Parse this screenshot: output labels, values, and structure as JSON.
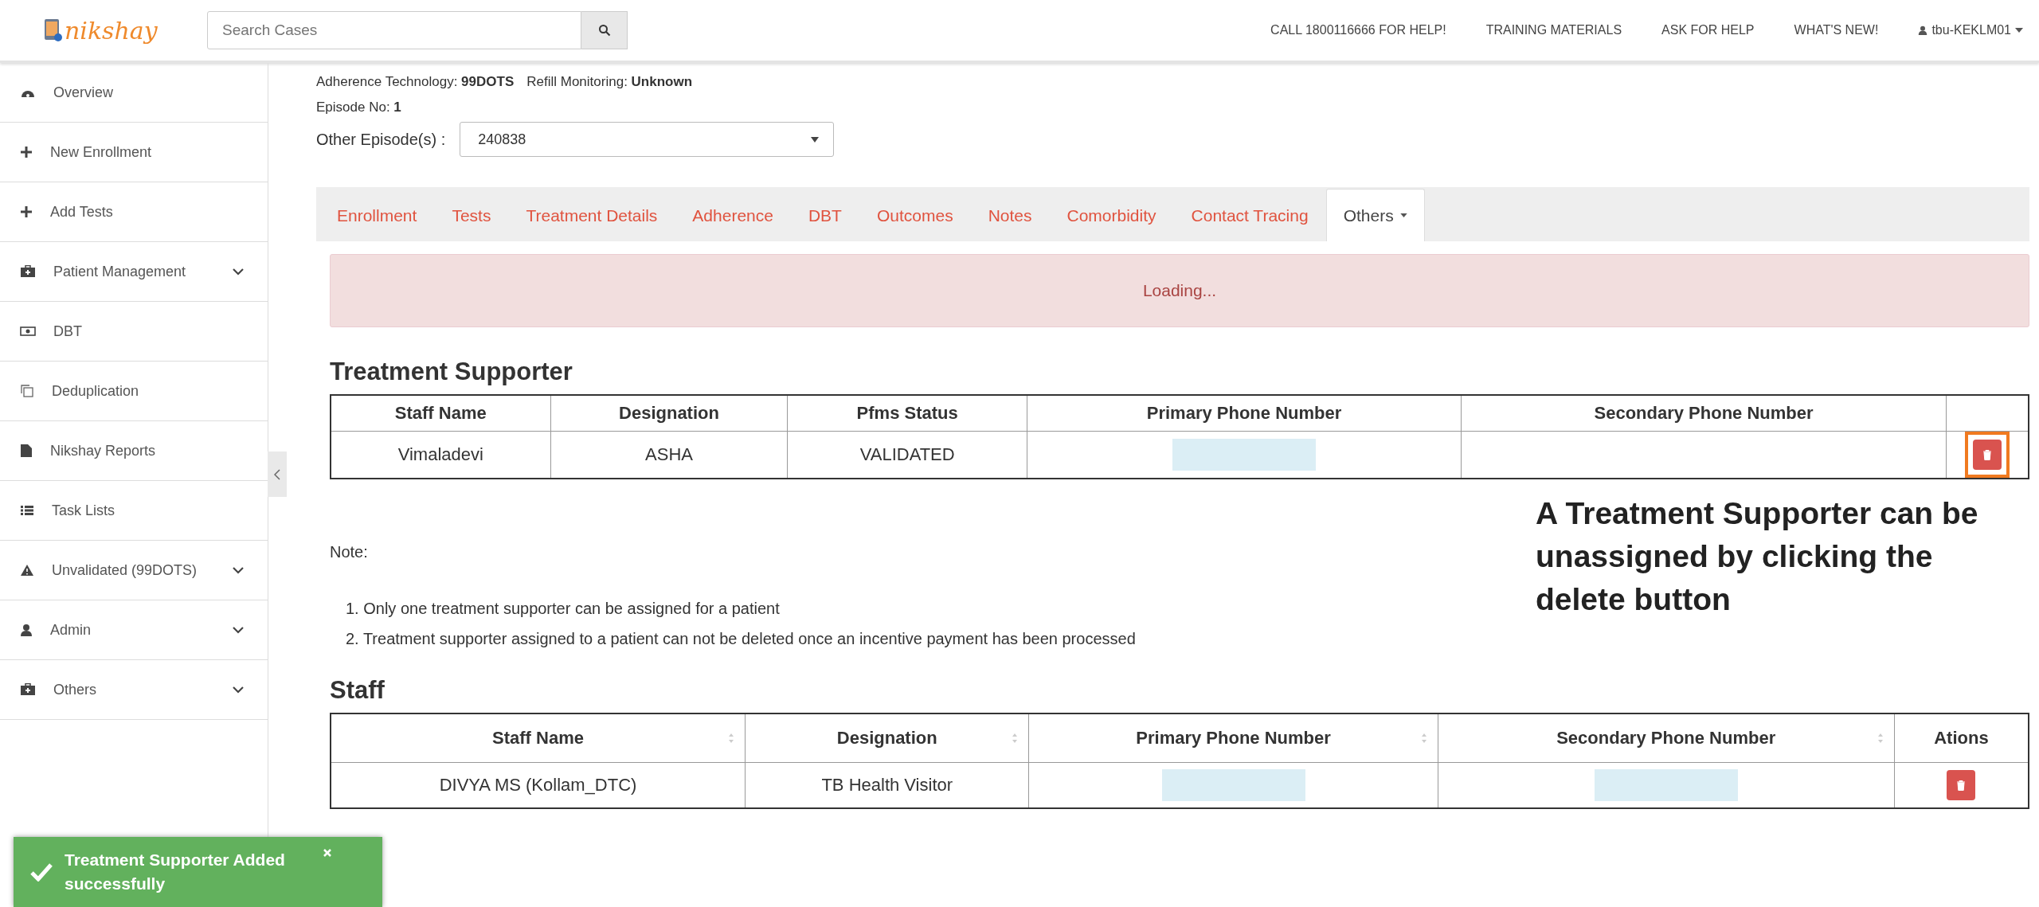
{
  "header": {
    "logo": "nikshay",
    "search": {
      "placeholder": "Search Cases"
    },
    "links": [
      "CALL 1800116666 FOR HELP!",
      "TRAINING MATERIALS",
      "ASK FOR HELP",
      "WHAT'S NEW!"
    ],
    "user": "tbu-KEKLM01"
  },
  "sidebar": {
    "items": [
      {
        "label": "Overview",
        "expandable": false
      },
      {
        "label": "New Enrollment",
        "expandable": false
      },
      {
        "label": "Add Tests",
        "expandable": false
      },
      {
        "label": "Patient Management",
        "expandable": true
      },
      {
        "label": "DBT",
        "expandable": false
      },
      {
        "label": "Deduplication",
        "expandable": false
      },
      {
        "label": "Nikshay Reports",
        "expandable": false
      },
      {
        "label": "Task Lists",
        "expandable": false
      },
      {
        "label": "Unvalidated (99DOTS)",
        "expandable": true
      },
      {
        "label": "Admin",
        "expandable": true
      },
      {
        "label": "Others",
        "expandable": true
      }
    ]
  },
  "info": {
    "adherence_label": "Adherence Technology:",
    "adherence_value": "99DOTS",
    "refill_label": "Refill Monitoring:",
    "refill_value": "Unknown",
    "episode_label": "Episode No:",
    "episode_value": "1",
    "other_episodes_label": "Other Episode(s) :",
    "other_episodes_value": "240838"
  },
  "tabs": [
    {
      "label": "Enrollment",
      "selected": false,
      "dropdown": false
    },
    {
      "label": "Tests",
      "selected": false,
      "dropdown": false
    },
    {
      "label": "Treatment Details",
      "selected": false,
      "dropdown": false
    },
    {
      "label": "Adherence",
      "selected": false,
      "dropdown": false
    },
    {
      "label": "DBT",
      "selected": false,
      "dropdown": false
    },
    {
      "label": "Outcomes",
      "selected": false,
      "dropdown": false
    },
    {
      "label": "Notes",
      "selected": false,
      "dropdown": false
    },
    {
      "label": "Comorbidity",
      "selected": false,
      "dropdown": false
    },
    {
      "label": "Contact Tracing",
      "selected": false,
      "dropdown": false
    },
    {
      "label": "Others",
      "selected": true,
      "dropdown": true
    }
  ],
  "alert": "Loading...",
  "treatment_supporter": {
    "title": "Treatment Supporter",
    "columns": [
      "Staff Name",
      "Designation",
      "Pfms Status",
      "Primary Phone Number",
      "Secondary Phone Number"
    ],
    "rows": [
      {
        "cells": [
          "Vimaladevi",
          "ASHA",
          "VALIDATED"
        ],
        "primary_redacted": true,
        "secondary_redacted": false,
        "delete_highlighted": true
      }
    ]
  },
  "annotation": "A Treatment Supporter can be unassigned by clicking the delete button",
  "note": {
    "label": "Note:",
    "items": [
      "1. Only one treatment supporter can be assigned for a patient",
      "2. Treatment supporter assigned to a patient can not be deleted once an incentive payment has been processed"
    ]
  },
  "staff": {
    "title": "Staff",
    "columns": [
      {
        "label": "Staff Name",
        "sortable": true
      },
      {
        "label": "Designation",
        "sortable": true
      },
      {
        "label": "Primary Phone Number",
        "sortable": true
      },
      {
        "label": "Secondary Phone Number",
        "sortable": true
      },
      {
        "label": "Ations",
        "sortable": false
      }
    ],
    "rows": [
      {
        "cells": [
          "DIVYA MS (Kollam_DTC)",
          "TB Health Visitor"
        ],
        "primary_redacted": true,
        "secondary_redacted": true
      }
    ]
  },
  "toast": {
    "message": "Treatment Supporter Added successfully"
  }
}
